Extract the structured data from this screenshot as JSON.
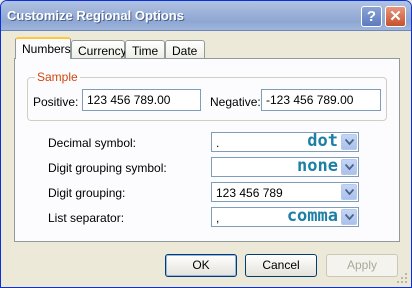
{
  "window": {
    "title": "Customize Regional Options"
  },
  "title_buttons": {
    "help": "?",
    "close": "✕"
  },
  "tabs": [
    {
      "label": "Numbers",
      "active": true
    },
    {
      "label": "Currency",
      "active": false
    },
    {
      "label": "Time",
      "active": false
    },
    {
      "label": "Date",
      "active": false
    }
  ],
  "sample": {
    "legend": "Sample",
    "positive_label": "Positive:",
    "positive_value": "123 456 789.00",
    "negative_label": "Negative:",
    "negative_value": "-123 456 789.00"
  },
  "settings": [
    {
      "label": "Decimal symbol:",
      "value": ".",
      "tag": "dot"
    },
    {
      "label": "Digit grouping symbol:",
      "value": "",
      "tag": "none"
    },
    {
      "label": "Digit grouping:",
      "value": "123 456 789",
      "tag": ""
    },
    {
      "label": "List separator:",
      "value": ",",
      "tag": "comma"
    }
  ],
  "buttons": {
    "ok": "OK",
    "cancel": "Cancel",
    "apply": "Apply"
  },
  "colors": {
    "legend": "#d0460c",
    "tag": "#1d7fa6",
    "title_bar": "#9db2d9"
  }
}
